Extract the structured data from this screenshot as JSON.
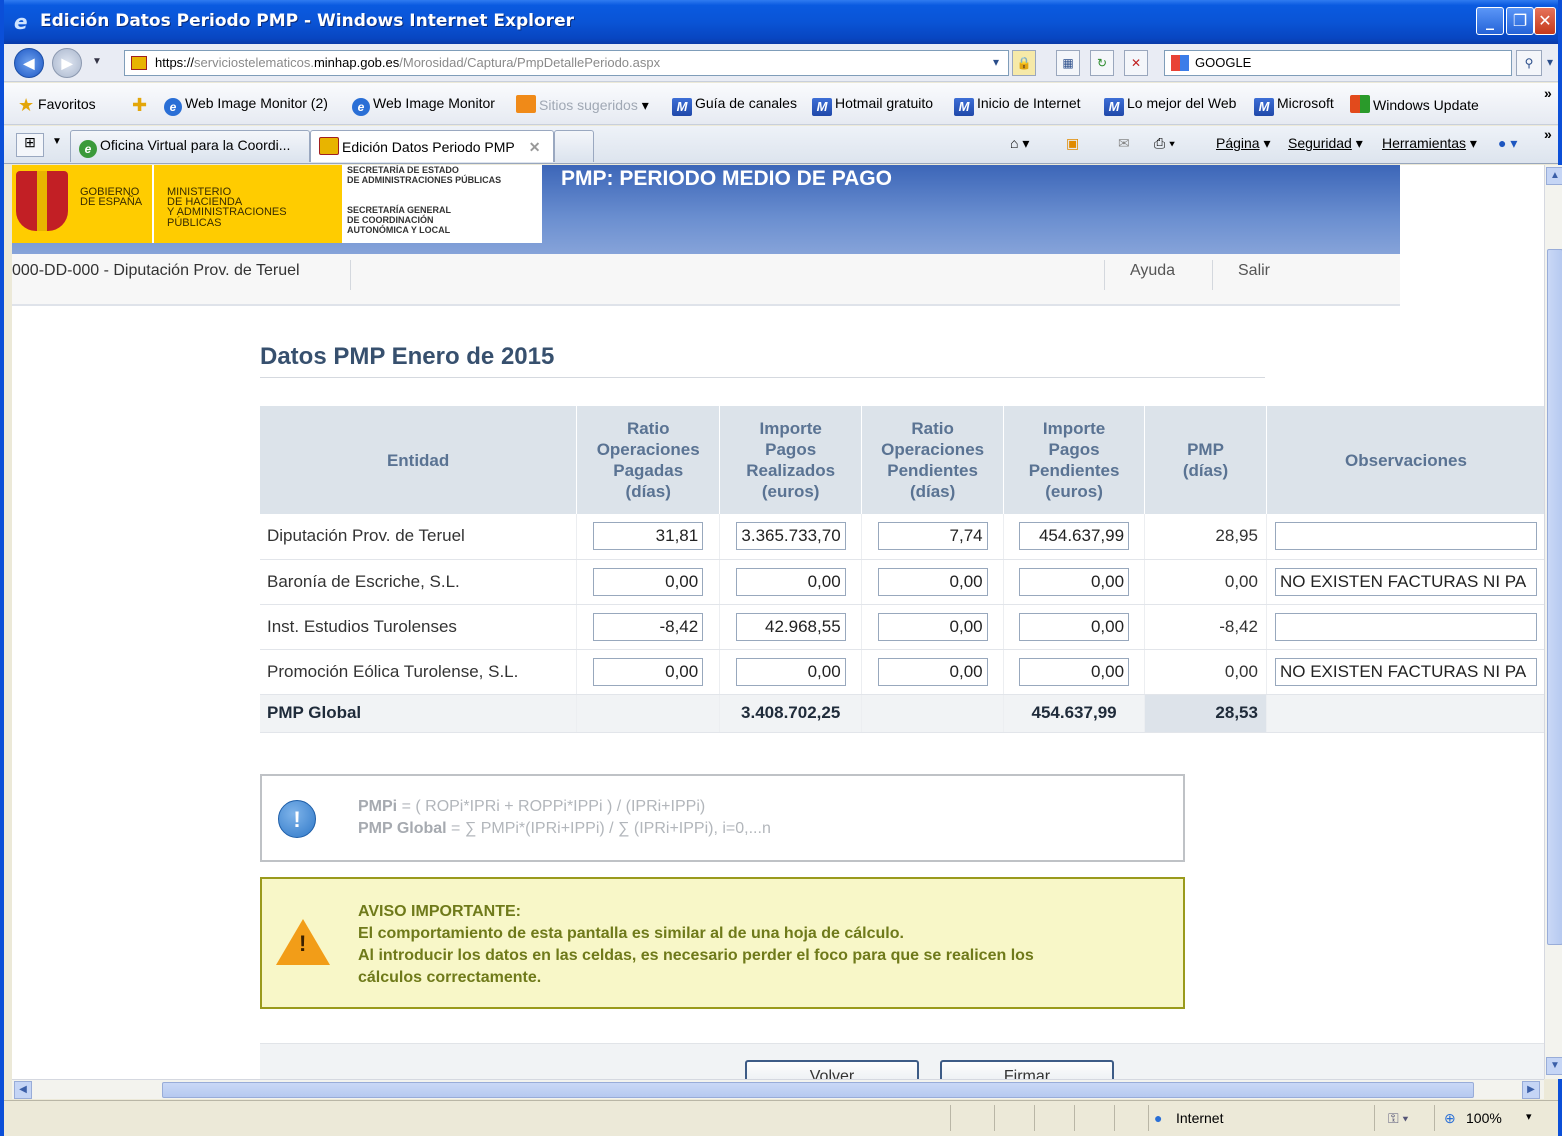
{
  "window": {
    "title": "Edición Datos Periodo PMP - Windows Internet Explorer",
    "min": "_",
    "max": "❐",
    "close": "✕"
  },
  "address": {
    "scheme": "https://",
    "pre": "serviciostelematicos.",
    "host": "minhap.gob.es",
    "path": "/Morosidad/Captura/PmpDetallePeriodo.aspx"
  },
  "search": {
    "value": "GOOGLE"
  },
  "favorites": {
    "label": "Favoritos",
    "items": [
      "Web Image Monitor (2)",
      "Web Image Monitor",
      "Sitios sugeridos",
      "Guía de canales",
      "Hotmail gratuito",
      "Inicio de Internet",
      "Lo mejor del Web",
      "Microsoft",
      "Windows Update"
    ]
  },
  "tabs": [
    {
      "label": "Oficina Virtual para la Coordi..."
    },
    {
      "label": "Edición Datos Periodo PMP"
    }
  ],
  "commands": {
    "pagina": "Página",
    "seguridad": "Seguridad",
    "herramientas": "Herramientas"
  },
  "site": {
    "gov1": "GOBIERNO",
    "gov2": "DE ESPAÑA",
    "min1": "MINISTERIO",
    "min2": "DE HACIENDA",
    "min3": "Y ADMINISTRACIONES PÚBLICAS",
    "sec1": "SECRETARÍA DE ESTADO",
    "sec2": "DE ADMINISTRACIONES PÚBLICAS",
    "sg1": "SECRETARÍA GENERAL",
    "sg2": "DE COORDINACIÓN",
    "sg3": "AUTONÓMICA Y LOCAL",
    "title": "PMP: PERIODO MEDIO DE PAGO"
  },
  "userbar": {
    "entity": "000-DD-000 - Diputación Prov. de Teruel",
    "help": "Ayuda",
    "exit": "Salir"
  },
  "main": {
    "title": "Datos PMP Enero de 2015",
    "columns": {
      "entidad": "Entidad",
      "rop": [
        "Ratio",
        "Operaciones",
        "Pagadas",
        "(días)"
      ],
      "ipr": [
        "Importe",
        "Pagos",
        "Realizados",
        "(euros)"
      ],
      "ropp": [
        "Ratio",
        "Operaciones",
        "Pendientes",
        "(días)"
      ],
      "ipp": [
        "Importe",
        "Pagos",
        "Pendientes",
        "(euros)"
      ],
      "pmp": [
        "PMP",
        "(días)"
      ],
      "obs": "Observaciones"
    },
    "rows": [
      {
        "entidad": "Diputación Prov. de Teruel",
        "rop": "31,81",
        "ipr": "3.365.733,70",
        "ropp": "7,74",
        "ipp": "454.637,99",
        "pmp": "28,95",
        "obs": ""
      },
      {
        "entidad": "Baronía de Escriche, S.L.",
        "rop": "0,00",
        "ipr": "0,00",
        "ropp": "0,00",
        "ipp": "0,00",
        "pmp": "0,00",
        "obs": "NO EXISTEN FACTURAS NI PA"
      },
      {
        "entidad": "Inst. Estudios Turolenses",
        "rop": "-8,42",
        "ipr": "42.968,55",
        "ropp": "0,00",
        "ipp": "0,00",
        "pmp": "-8,42",
        "obs": ""
      },
      {
        "entidad": "Promoción Eólica Turolense, S.L.",
        "rop": "0,00",
        "ipr": "0,00",
        "ropp": "0,00",
        "ipp": "0,00",
        "pmp": "0,00",
        "obs": "NO EXISTEN FACTURAS NI PA"
      }
    ],
    "total": {
      "label": "PMP Global",
      "ipr": "3.408.702,25",
      "ipp": "454.637,99",
      "pmp": "28,53"
    },
    "info": {
      "l1_bold": "PMPi",
      "l1_rest": " = ( ROPi*IPRi + ROPPi*IPPi ) / (IPRi+IPPi)",
      "l2_bold": "PMP Global",
      "l2_rest": " = ∑ PMPi*(IPRi+IPPi) / ∑ (IPRi+IPPi), i=0,...n"
    },
    "warning": {
      "title": "AVISO IMPORTANTE:",
      "l1": "El comportamiento de esta pantalla es similar al de una hoja de cálculo.",
      "l2": "Al introducir los datos en las celdas, es necesario perder el foco para que se realicen los",
      "l3": "cálculos correctamente."
    },
    "buttons": {
      "back": "Volver",
      "sign": "Firmar"
    }
  },
  "status": {
    "zone": "Internet",
    "zoom": "100%"
  }
}
